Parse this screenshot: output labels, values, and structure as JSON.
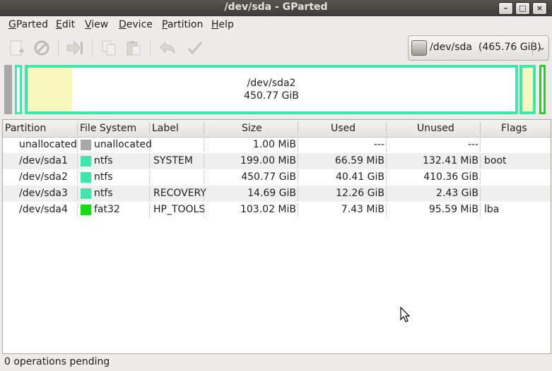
{
  "window": {
    "title": "/dev/sda - GParted"
  },
  "menu": [
    {
      "label": "GParted",
      "mnemonic": "G",
      "rest": "Parted"
    },
    {
      "label": "Edit",
      "mnemonic": "E",
      "rest": "dit"
    },
    {
      "label": "View",
      "mnemonic": "V",
      "rest": "iew"
    },
    {
      "label": "Device",
      "mnemonic": "D",
      "rest": "evice"
    },
    {
      "label": "Partition",
      "mnemonic": "P",
      "rest": "artition"
    },
    {
      "label": "Help",
      "mnemonic": "H",
      "rest": "elp"
    }
  ],
  "toolbar": {
    "icons": [
      "new-partition-icon",
      "delete-icon",
      "resize-move-icon",
      "copy-icon",
      "paste-icon",
      "undo-icon",
      "apply-icon"
    ]
  },
  "device": {
    "selected": "/dev/sda  (465.76 GiB)"
  },
  "diskmap": {
    "selected_label": "/dev/sda2",
    "selected_size": "450.77 GiB",
    "colors": {
      "unallocated": "#a8a8a8",
      "ntfs": "#42e5ac",
      "fat32": "#18d918",
      "used": "#f8f8bc"
    }
  },
  "table": {
    "headers": [
      "Partition",
      "File System",
      "Label",
      "Size",
      "Used",
      "Unused",
      "Flags"
    ],
    "rows": [
      {
        "partition": "unallocated",
        "fs": "unallocated",
        "fs_color": "#a8a8a8",
        "label": "",
        "size": "1.00 MiB",
        "used": "---",
        "unused": "---",
        "flags": ""
      },
      {
        "partition": "/dev/sda1",
        "fs": "ntfs",
        "fs_color": "#42e5ac",
        "label": "SYSTEM",
        "size": "199.00 MiB",
        "used": "66.59 MiB",
        "unused": "132.41 MiB",
        "flags": "boot"
      },
      {
        "partition": "/dev/sda2",
        "fs": "ntfs",
        "fs_color": "#42e5ac",
        "label": "",
        "size": "450.77 GiB",
        "used": "40.41 GiB",
        "unused": "410.36 GiB",
        "flags": ""
      },
      {
        "partition": "/dev/sda3",
        "fs": "ntfs",
        "fs_color": "#42e5ac",
        "label": "RECOVERY",
        "size": "14.69 GiB",
        "used": "12.26 GiB",
        "unused": "2.43 GiB",
        "flags": ""
      },
      {
        "partition": "/dev/sda4",
        "fs": "fat32",
        "fs_color": "#18d918",
        "label": "HP_TOOLS",
        "size": "103.02 MiB",
        "used": "7.43 MiB",
        "unused": "95.59 MiB",
        "flags": "lba"
      }
    ]
  },
  "status": {
    "text": "0 operations pending"
  }
}
